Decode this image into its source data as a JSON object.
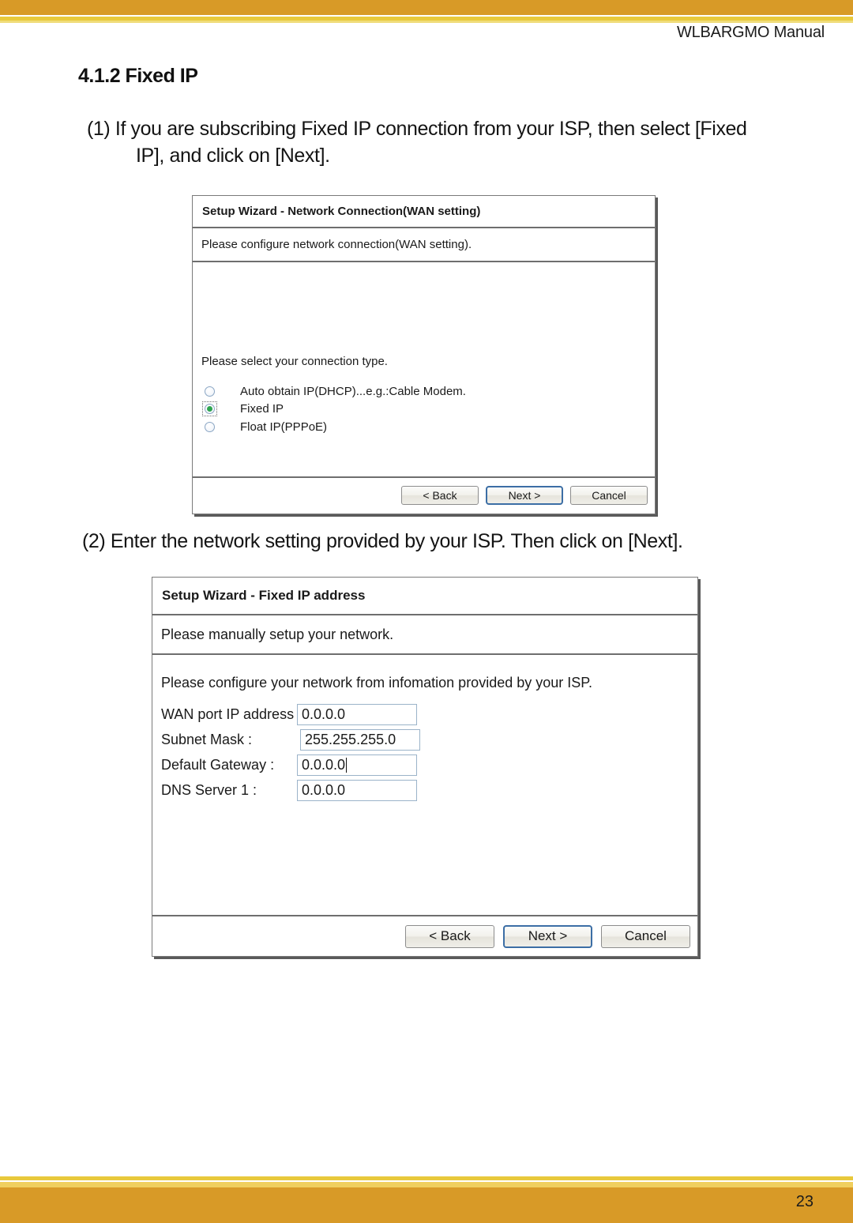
{
  "page": {
    "running_header": "WLBARGMO Manual",
    "page_number": "23",
    "accent_gold": "#d89a27",
    "accent_yellow": "#e8c93c"
  },
  "section": {
    "heading": "4.1.2 Fixed IP"
  },
  "steps": [
    {
      "line1": "(1) If you are subscribing Fixed IP connection from your ISP, then select [Fixed",
      "line2": "IP], and click on [Next]."
    },
    {
      "line1": "(2) Enter the network setting provided by your ISP. Then click on [Next]."
    }
  ],
  "dialog_wan": {
    "title": "Setup Wizard - Network Connection(WAN setting)",
    "subtitle": "Please configure network connection(WAN setting).",
    "prompt": "Please select your connection type.",
    "options": [
      {
        "label": "Auto obtain IP(DHCP)...e.g.:Cable Modem.",
        "selected": false
      },
      {
        "label": "Fixed IP",
        "selected": true
      },
      {
        "label": "Float IP(PPPoE)",
        "selected": false
      }
    ],
    "buttons": {
      "back": "< Back",
      "next": "Next >",
      "cancel": "Cancel"
    }
  },
  "dialog_fixedip": {
    "title": "Setup Wizard - Fixed IP address",
    "subtitle": "Please manually setup your network.",
    "prompt": "Please configure your network from infomation provided by your ISP.",
    "fields": [
      {
        "label": "WAN port IP address :",
        "value": "0.0.0.0"
      },
      {
        "label": "Subnet Mask :",
        "value": "255.255.255.0"
      },
      {
        "label": "Default Gateway :",
        "value": "0.0.0.0"
      },
      {
        "label": "DNS Server 1 :",
        "value": "0.0.0.0"
      }
    ],
    "buttons": {
      "back": "< Back",
      "next": "Next >",
      "cancel": "Cancel"
    }
  }
}
